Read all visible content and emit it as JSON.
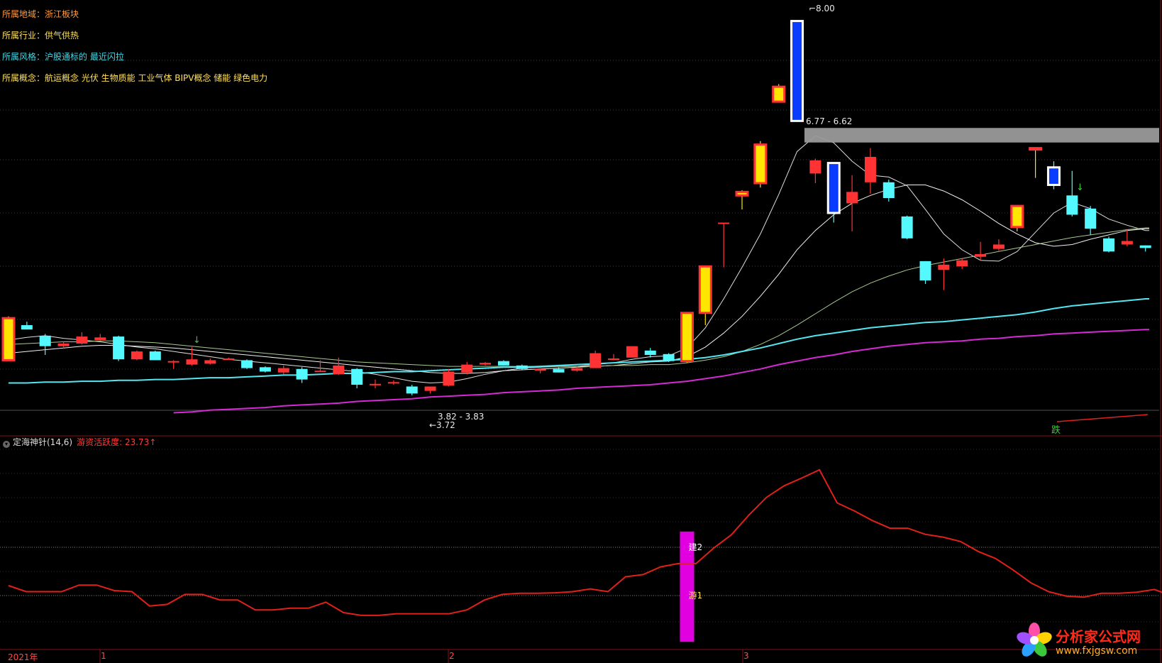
{
  "info_lines": [
    {
      "label": "所属地域：",
      "value": "浙江板块",
      "color": "#ff9a3c"
    },
    {
      "label": "所属行业：",
      "value": "供气供热",
      "color": "#ffe15a"
    },
    {
      "label": "所属风格：",
      "value": "沪股通标的 最近闪拉",
      "color": "#3fd8e8"
    },
    {
      "label": "所属概念：",
      "value": "航运概念 光伏 生物质能 工业气体 BIPV概念 储能 绿色电力",
      "color": "#ffe15a"
    }
  ],
  "indicator": {
    "name": "定海神针(14,6)",
    "series_label": "游资活跃度:",
    "value": "23.73",
    "arrow": "↑",
    "level_labels": [
      "建2",
      "游1"
    ]
  },
  "annotations": {
    "high": "8.00",
    "low": "3.72",
    "range_high": "6.77 - 6.62",
    "range_low": "3.82 - 3.83",
    "fall_marker": "跌"
  },
  "x_axis_labels": [
    "2021年",
    "1",
    "2",
    "3"
  ],
  "logo": {
    "title": "分析家公式网",
    "url": "www.fxjgsw.com"
  },
  "colors": {
    "up": "#ff3333",
    "down": "#54f8ff",
    "signal_yellow": "#ffe600",
    "signal_blue": "#0a3cff",
    "ma_cyan": "#54e6f0",
    "ma_magenta": "#d42ad4",
    "indicator_line": "#e0201a",
    "bar_magenta": "#e000e0"
  },
  "chart_data": [
    {
      "type": "candlestick",
      "title": "",
      "price_range": [
        3.5,
        8.1
      ],
      "candles": [
        {
          "o": 4.6,
          "h": 4.62,
          "l": 4.12,
          "c": 4.12,
          "k": "sig_up"
        },
        {
          "o": 4.52,
          "h": 4.56,
          "l": 4.48,
          "c": 4.47,
          "k": "down"
        },
        {
          "o": 4.4,
          "h": 4.42,
          "l": 4.18,
          "c": 4.28,
          "k": "down"
        },
        {
          "o": 4.28,
          "h": 4.33,
          "l": 4.25,
          "c": 4.31,
          "k": "up"
        },
        {
          "o": 4.31,
          "h": 4.44,
          "l": 4.3,
          "c": 4.39,
          "k": "up"
        },
        {
          "o": 4.38,
          "h": 4.42,
          "l": 4.34,
          "c": 4.35,
          "k": "up"
        },
        {
          "o": 4.39,
          "h": 4.4,
          "l": 4.11,
          "c": 4.13,
          "k": "down"
        },
        {
          "o": 4.13,
          "h": 4.23,
          "l": 4.12,
          "c": 4.22,
          "k": "up"
        },
        {
          "o": 4.22,
          "h": 4.23,
          "l": 4.12,
          "c": 4.12,
          "k": "down"
        },
        {
          "o": 4.11,
          "h": 4.12,
          "l": 4.02,
          "c": 4.1,
          "k": "up"
        },
        {
          "o": 4.07,
          "h": 4.27,
          "l": 4.06,
          "c": 4.13,
          "k": "up"
        },
        {
          "o": 4.08,
          "h": 4.14,
          "l": 4.07,
          "c": 4.12,
          "k": "up"
        },
        {
          "o": 4.14,
          "h": 4.15,
          "l": 4.13,
          "c": 4.14,
          "k": "up"
        },
        {
          "o": 4.12,
          "h": 4.13,
          "l": 4.02,
          "c": 4.03,
          "k": "down"
        },
        {
          "o": 4.04,
          "h": 4.05,
          "l": 3.98,
          "c": 3.99,
          "k": "down"
        },
        {
          "o": 3.98,
          "h": 4.06,
          "l": 3.96,
          "c": 4.03,
          "k": "up"
        },
        {
          "o": 4.02,
          "h": 4.04,
          "l": 3.86,
          "c": 3.9,
          "k": "down"
        },
        {
          "o": 4.0,
          "h": 4.12,
          "l": 3.99,
          "c": 4.0,
          "k": "up"
        },
        {
          "o": 3.96,
          "h": 4.15,
          "l": 3.95,
          "c": 4.06,
          "k": "up"
        },
        {
          "o": 4.02,
          "h": 4.03,
          "l": 3.8,
          "c": 3.84,
          "k": "down"
        },
        {
          "o": 3.85,
          "h": 3.9,
          "l": 3.8,
          "c": 3.85,
          "k": "up"
        },
        {
          "o": 3.86,
          "h": 3.89,
          "l": 3.84,
          "c": 3.87,
          "k": "up"
        },
        {
          "o": 3.82,
          "h": 3.84,
          "l": 3.72,
          "c": 3.74,
          "k": "down"
        },
        {
          "o": 3.77,
          "h": 3.82,
          "l": 3.74,
          "c": 3.82,
          "k": "up"
        },
        {
          "o": 3.83,
          "h": 4.02,
          "l": 3.82,
          "c": 3.99,
          "k": "up"
        },
        {
          "o": 3.98,
          "h": 4.1,
          "l": 3.96,
          "c": 4.07,
          "k": "up"
        },
        {
          "o": 4.07,
          "h": 4.1,
          "l": 4.06,
          "c": 4.09,
          "k": "up"
        },
        {
          "o": 4.11,
          "h": 4.12,
          "l": 4.06,
          "c": 4.06,
          "k": "down"
        },
        {
          "o": 4.06,
          "h": 4.07,
          "l": 4.01,
          "c": 4.02,
          "k": "down"
        },
        {
          "o": 4.0,
          "h": 4.03,
          "l": 3.97,
          "c": 4.02,
          "k": "up"
        },
        {
          "o": 4.02,
          "h": 4.04,
          "l": 3.98,
          "c": 3.98,
          "k": "down"
        },
        {
          "o": 4.0,
          "h": 4.05,
          "l": 3.99,
          "c": 4.03,
          "k": "up"
        },
        {
          "o": 4.03,
          "h": 4.23,
          "l": 4.03,
          "c": 4.2,
          "k": "up"
        },
        {
          "o": 4.13,
          "h": 4.19,
          "l": 4.12,
          "c": 4.14,
          "k": "up"
        },
        {
          "o": 4.15,
          "h": 4.28,
          "l": 4.15,
          "c": 4.28,
          "k": "up"
        },
        {
          "o": 4.23,
          "h": 4.26,
          "l": 4.15,
          "c": 4.18,
          "k": "down"
        },
        {
          "o": 4.19,
          "h": 4.2,
          "l": 4.1,
          "c": 4.11,
          "k": "down"
        },
        {
          "o": 4.11,
          "h": 4.66,
          "l": 4.09,
          "c": 4.66,
          "k": "sig_up"
        },
        {
          "o": 4.66,
          "h": 5.19,
          "l": 4.52,
          "c": 5.19,
          "k": "sig_up"
        },
        {
          "o": 5.69,
          "h": 5.68,
          "l": 5.18,
          "c": 5.69,
          "k": "up"
        },
        {
          "o": 6.04,
          "h": 6.06,
          "l": 5.84,
          "c": 6.0,
          "k": "sig_up"
        },
        {
          "o": 6.14,
          "h": 6.62,
          "l": 6.09,
          "c": 6.58,
          "k": "sig_up"
        },
        {
          "o": 7.24,
          "h": 7.27,
          "l": 7.1,
          "c": 7.07,
          "k": "sig_up"
        },
        {
          "o": 7.99,
          "h": 8.0,
          "l": 6.85,
          "c": 6.85,
          "k": "sig_down"
        },
        {
          "o": 6.4,
          "h": 6.42,
          "l": 6.14,
          "c": 6.25,
          "k": "up"
        },
        {
          "o": 6.37,
          "h": 6.38,
          "l": 5.69,
          "c": 5.8,
          "k": "sig_down"
        },
        {
          "o": 5.91,
          "h": 6.23,
          "l": 5.59,
          "c": 6.04,
          "k": "up"
        },
        {
          "o": 6.44,
          "h": 6.54,
          "l": 6.02,
          "c": 6.15,
          "k": "up"
        },
        {
          "o": 6.15,
          "h": 6.18,
          "l": 5.93,
          "c": 5.97,
          "k": "down"
        },
        {
          "o": 5.76,
          "h": 5.77,
          "l": 5.5,
          "c": 5.51,
          "k": "down"
        },
        {
          "o": 5.25,
          "h": 5.25,
          "l": 4.99,
          "c": 5.03,
          "k": "down"
        },
        {
          "o": 5.15,
          "h": 5.28,
          "l": 4.92,
          "c": 5.21,
          "k": "up"
        },
        {
          "o": 5.19,
          "h": 5.28,
          "l": 5.16,
          "c": 5.26,
          "k": "up"
        },
        {
          "o": 5.3,
          "h": 5.47,
          "l": 5.26,
          "c": 5.33,
          "k": "up"
        },
        {
          "o": 5.39,
          "h": 5.5,
          "l": 5.37,
          "c": 5.44,
          "k": "up"
        },
        {
          "o": 5.64,
          "h": 5.88,
          "l": 5.59,
          "c": 5.88,
          "k": "sig_up"
        },
        {
          "o": 6.54,
          "h": 6.54,
          "l": 6.2,
          "c": 6.54,
          "k": "sig_up"
        },
        {
          "o": 6.32,
          "h": 6.39,
          "l": 6.07,
          "c": 6.12,
          "k": "sig_down"
        },
        {
          "o": 6.0,
          "h": 6.28,
          "l": 5.76,
          "c": 5.78,
          "k": "down"
        },
        {
          "o": 5.85,
          "h": 5.88,
          "l": 5.55,
          "c": 5.62,
          "k": "down"
        },
        {
          "o": 5.51,
          "h": 5.53,
          "l": 5.35,
          "c": 5.36,
          "k": "down"
        },
        {
          "o": 5.44,
          "h": 5.61,
          "l": 5.42,
          "c": 5.48,
          "k": "up"
        },
        {
          "o": 5.4,
          "h": 5.43,
          "l": 5.36,
          "c": 5.43,
          "k": "down"
        }
      ],
      "moving_averages": [
        {
          "color": "#dddddd",
          "values": [
            4.35,
            4.38,
            4.4,
            4.37,
            4.35,
            4.33,
            4.3,
            4.27,
            4.25,
            4.22,
            4.19,
            4.16,
            4.13,
            4.11,
            4.09,
            4.07,
            4.05,
            4.03,
            4.01,
            3.99,
            3.96,
            3.92,
            3.88,
            3.86,
            3.87,
            3.91,
            3.96,
            4.0,
            4.03,
            4.04,
            4.05,
            4.05,
            4.07,
            4.09,
            4.13,
            4.16,
            4.17,
            4.26,
            4.49,
            4.82,
            5.18,
            5.56,
            6.01,
            6.5,
            6.68,
            6.6,
            6.39,
            6.23,
            6.21,
            6.11,
            5.84,
            5.56,
            5.38,
            5.26,
            5.25,
            5.36,
            5.58,
            5.8,
            5.92,
            5.85,
            5.73,
            5.66,
            5.6
          ]
        },
        {
          "color": "#f0f0f0",
          "values": [
            4.2,
            4.22,
            4.24,
            4.26,
            4.28,
            4.29,
            4.29,
            4.28,
            4.27,
            4.26,
            4.24,
            4.22,
            4.2,
            4.18,
            4.16,
            4.14,
            4.12,
            4.1,
            4.08,
            4.06,
            4.04,
            4.02,
            4.0,
            3.98,
            3.97,
            3.97,
            3.98,
            4.0,
            4.01,
            4.02,
            4.03,
            4.04,
            4.05,
            4.06,
            4.08,
            4.1,
            4.11,
            4.16,
            4.27,
            4.43,
            4.62,
            4.85,
            5.1,
            5.38,
            5.6,
            5.78,
            5.91,
            6.0,
            6.07,
            6.12,
            6.12,
            6.05,
            5.95,
            5.82,
            5.68,
            5.56,
            5.46,
            5.42,
            5.44,
            5.5,
            5.55,
            5.6,
            5.62
          ]
        },
        {
          "color": "#a8c890",
          "values": [
            4.3,
            4.31,
            4.32,
            4.33,
            4.33,
            4.34,
            4.34,
            4.33,
            4.32,
            4.3,
            4.28,
            4.26,
            4.24,
            4.22,
            4.2,
            4.18,
            4.16,
            4.14,
            4.12,
            4.1,
            4.09,
            4.08,
            4.07,
            4.06,
            4.05,
            4.05,
            4.05,
            4.05,
            4.05,
            4.05,
            4.05,
            4.05,
            4.05,
            4.06,
            4.06,
            4.07,
            4.07,
            4.09,
            4.12,
            4.16,
            4.22,
            4.3,
            4.4,
            4.52,
            4.65,
            4.78,
            4.9,
            5.0,
            5.08,
            5.15,
            5.2,
            5.24,
            5.28,
            5.32,
            5.36,
            5.4,
            5.44,
            5.48,
            5.52,
            5.55,
            5.58,
            5.61,
            5.63
          ]
        },
        {
          "color": "#54e6f0",
          "values": [
            3.86,
            3.86,
            3.87,
            3.87,
            3.88,
            3.88,
            3.89,
            3.89,
            3.9,
            3.9,
            3.91,
            3.92,
            3.92,
            3.93,
            3.94,
            3.95,
            3.95,
            3.96,
            3.97,
            3.97,
            3.98,
            3.99,
            3.99,
            4.0,
            4.01,
            4.02,
            4.03,
            4.04,
            4.04,
            4.05,
            4.06,
            4.07,
            4.08,
            4.09,
            4.1,
            4.11,
            4.12,
            4.13,
            4.15,
            4.18,
            4.22,
            4.26,
            4.31,
            4.36,
            4.4,
            4.43,
            4.46,
            4.49,
            4.51,
            4.53,
            4.55,
            4.56,
            4.58,
            4.6,
            4.62,
            4.64,
            4.67,
            4.71,
            4.74,
            4.76,
            4.78,
            4.8,
            4.82
          ]
        },
        {
          "color": "#d42ad4",
          "values": [
            null,
            null,
            null,
            null,
            null,
            null,
            null,
            null,
            null,
            3.52,
            3.53,
            3.55,
            3.56,
            3.57,
            3.58,
            3.6,
            3.61,
            3.62,
            3.63,
            3.65,
            3.66,
            3.67,
            3.68,
            3.7,
            3.71,
            3.72,
            3.73,
            3.75,
            3.76,
            3.77,
            3.78,
            3.8,
            3.81,
            3.82,
            3.83,
            3.84,
            3.86,
            3.88,
            3.91,
            3.94,
            3.98,
            4.02,
            4.07,
            4.11,
            4.15,
            4.18,
            4.22,
            4.25,
            4.28,
            4.3,
            4.32,
            4.33,
            4.34,
            4.36,
            4.37,
            4.39,
            4.4,
            4.42,
            4.43,
            4.44,
            4.45,
            4.46,
            4.47
          ]
        }
      ]
    },
    {
      "type": "line",
      "title": "",
      "series": [
        {
          "name": "游资活跃度",
          "values": [
            14.2,
            13.1,
            13.1,
            13.1,
            14.3,
            14.3,
            13.3,
            13.1,
            10.5,
            10.8,
            12.6,
            12.6,
            11.6,
            11.6,
            9.8,
            9.8,
            10.1,
            10.1,
            11.2,
            9.3,
            8.8,
            8.8,
            9.1,
            9.1,
            9.1,
            9.1,
            9.8,
            11.6,
            12.6,
            12.8,
            12.8,
            12.9,
            13.1,
            13.6,
            13.1,
            15.8,
            16.2,
            17.6,
            18.2,
            18.2,
            21.0,
            23.4,
            27.0,
            30.2,
            32.3,
            33.7,
            35.2,
            29.2,
            27.7,
            26.0,
            24.6,
            24.6,
            23.5,
            23.0,
            22.2,
            20.4,
            19.1,
            17.0,
            14.7,
            13.1,
            12.3,
            12.1,
            12.8,
            12.8,
            13.0,
            13.5,
            12.3,
            12.9,
            13.0
          ]
        }
      ],
      "ylim": [
        3,
        38
      ],
      "signal_bar": {
        "index": 37,
        "from": 4,
        "to": 24
      }
    }
  ]
}
